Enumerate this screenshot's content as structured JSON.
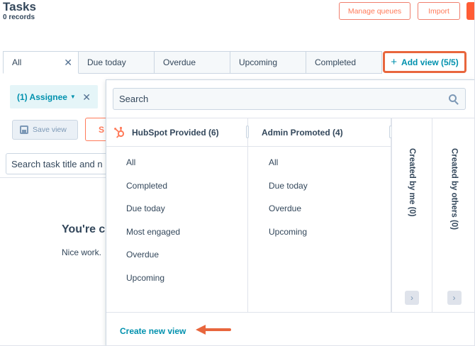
{
  "header": {
    "title": "Tasks",
    "record_count": "0 records",
    "manage_queues_label": "Manage queues",
    "import_label": "Import"
  },
  "tabs": [
    {
      "label": "All",
      "active": true,
      "closable": true
    },
    {
      "label": "Due today"
    },
    {
      "label": "Overdue"
    },
    {
      "label": "Upcoming"
    },
    {
      "label": "Completed"
    }
  ],
  "add_view": {
    "label": "Add view (5/5)",
    "icon": "plus-icon"
  },
  "filters": {
    "assignee_label": "(1) Assignee",
    "save_view_label": "Save view",
    "partial_button_label": "S",
    "search_placeholder": "Search task title and n"
  },
  "empty_state": {
    "title": "You're c",
    "subtitle": "Nice work."
  },
  "dropdown": {
    "search_placeholder": "Search",
    "columns": [
      {
        "title": "HubSpot Provided (6)",
        "icon": "hubspot-sprocket-icon",
        "items": [
          "All",
          "Completed",
          "Due today",
          "Most engaged",
          "Overdue",
          "Upcoming"
        ]
      },
      {
        "title": "Admin Promoted (4)",
        "items": [
          "All",
          "Due today",
          "Overdue",
          "Upcoming"
        ]
      },
      {
        "title": "Created by me (0)",
        "collapsed": true
      },
      {
        "title": "Created by others (0)",
        "collapsed": true
      }
    ],
    "create_new_view_label": "Create new view"
  },
  "colors": {
    "accent_teal": "#0091ae",
    "brand_orange": "#ff7a59",
    "highlight_annotation": "#e8663d",
    "text": "#33475b"
  }
}
